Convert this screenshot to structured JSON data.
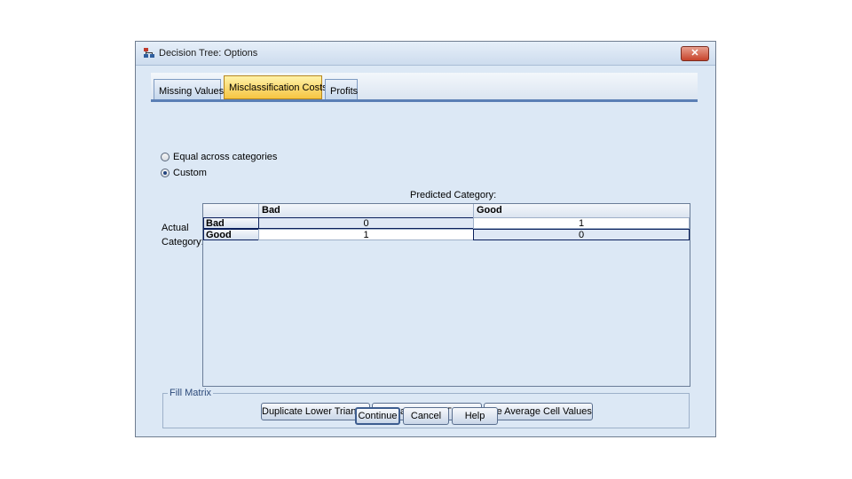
{
  "window": {
    "title": "Decision Tree: Options",
    "close_glyph": "✕"
  },
  "tabs": [
    {
      "label": "Missing Values",
      "active": false
    },
    {
      "label": "Misclassification Costs",
      "active": true
    },
    {
      "label": "Profits",
      "active": false
    }
  ],
  "radios": [
    {
      "label": "Equal across categories",
      "checked": false
    },
    {
      "label": "Custom",
      "checked": true
    }
  ],
  "matrix": {
    "predicted_label": "Predicted Category:",
    "actual_label_line1": "Actual",
    "actual_label_line2": "Category:",
    "columns": [
      "Bad",
      "Good"
    ],
    "rows": [
      {
        "label": "Bad",
        "values": [
          "0",
          "1"
        ]
      },
      {
        "label": "Good",
        "values": [
          "1",
          "0"
        ]
      }
    ]
  },
  "fill_matrix": {
    "legend": "Fill Matrix",
    "buttons": [
      "Duplicate Lower Triangle",
      "Duplicate Upper Triangle",
      "Use Average Cell Values"
    ]
  },
  "footer": {
    "continue": "Continue",
    "cancel": "Cancel",
    "help": "Help"
  },
  "colors": {
    "accent": "#f6c543",
    "dialog_bg": "#dce8f5",
    "close": "#c7432b"
  }
}
